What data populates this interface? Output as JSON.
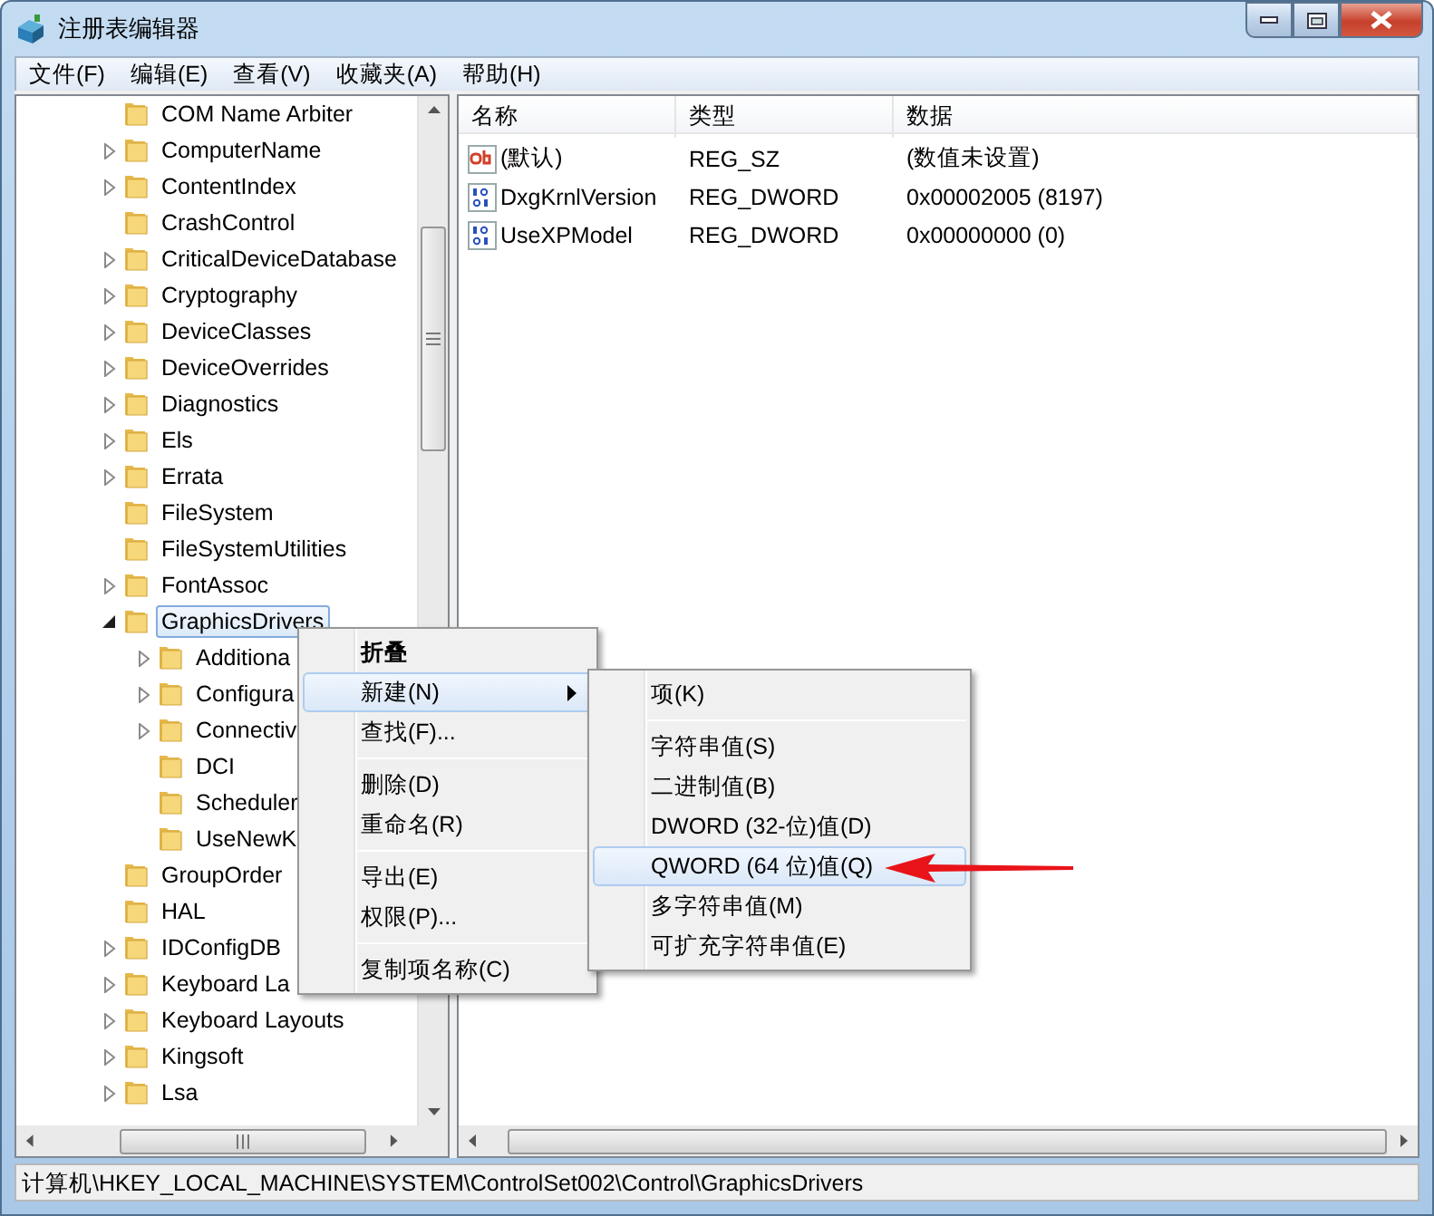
{
  "window": {
    "title": "注册表编辑器"
  },
  "menu_bar": [
    "文件(F)",
    "编辑(E)",
    "查看(V)",
    "收藏夹(A)",
    "帮助(H)"
  ],
  "tree": [
    {
      "label": "COM Name Arbiter",
      "has_children": false,
      "selected": false
    },
    {
      "label": "ComputerName",
      "has_children": true,
      "expanded": false,
      "selected": false
    },
    {
      "label": "ContentIndex",
      "has_children": true,
      "expanded": false,
      "selected": false
    },
    {
      "label": "CrashControl",
      "has_children": false,
      "selected": false
    },
    {
      "label": "CriticalDeviceDatabase",
      "has_children": true,
      "expanded": false,
      "selected": false
    },
    {
      "label": "Cryptography",
      "has_children": true,
      "expanded": false,
      "selected": false
    },
    {
      "label": "DeviceClasses",
      "has_children": true,
      "expanded": false,
      "selected": false
    },
    {
      "label": "DeviceOverrides",
      "has_children": true,
      "expanded": false,
      "selected": false
    },
    {
      "label": "Diagnostics",
      "has_children": true,
      "expanded": false,
      "selected": false
    },
    {
      "label": "Els",
      "has_children": true,
      "expanded": false,
      "selected": false
    },
    {
      "label": "Errata",
      "has_children": true,
      "expanded": false,
      "selected": false
    },
    {
      "label": "FileSystem",
      "has_children": false,
      "selected": false
    },
    {
      "label": "FileSystemUtilities",
      "has_children": false,
      "selected": false
    },
    {
      "label": "FontAssoc",
      "has_children": true,
      "expanded": false,
      "selected": false
    },
    {
      "label": "GraphicsDrivers",
      "has_children": true,
      "expanded": true,
      "selected": true,
      "children": [
        {
          "label": "Additiona",
          "has_children": true,
          "expanded": false,
          "selected": false
        },
        {
          "label": "Configura",
          "has_children": true,
          "expanded": false,
          "selected": false
        },
        {
          "label": "Connectiv",
          "has_children": true,
          "expanded": false,
          "selected": false
        },
        {
          "label": "DCI",
          "has_children": false,
          "selected": false
        },
        {
          "label": "Scheduler",
          "has_children": false,
          "selected": false
        },
        {
          "label": "UseNewK",
          "has_children": false,
          "selected": false
        }
      ]
    },
    {
      "label": "GroupOrder",
      "has_children": false,
      "selected": false
    },
    {
      "label": "HAL",
      "has_children": false,
      "selected": false
    },
    {
      "label": "IDConfigDB",
      "has_children": true,
      "expanded": false,
      "selected": false
    },
    {
      "label": "Keyboard La",
      "has_children": true,
      "expanded": false,
      "selected": false
    },
    {
      "label": "Keyboard Layouts",
      "has_children": true,
      "expanded": false,
      "selected": false
    },
    {
      "label": "Kingsoft",
      "has_children": true,
      "expanded": false,
      "selected": false
    },
    {
      "label": "Lsa",
      "has_children": true,
      "expanded": false,
      "selected": false
    }
  ],
  "values": {
    "columns": [
      "名称",
      "类型",
      "数据"
    ],
    "rows": [
      {
        "kind": "string",
        "name": "(默认)",
        "type": "REG_SZ",
        "data": "(数值未设置)"
      },
      {
        "kind": "binary",
        "name": "DxgKrnlVersion",
        "type": "REG_DWORD",
        "data": "0x00002005 (8197)"
      },
      {
        "kind": "binary",
        "name": "UseXPModel",
        "type": "REG_DWORD",
        "data": "0x00000000 (0)"
      }
    ]
  },
  "context_menu": [
    {
      "kind": "item",
      "label": "折叠",
      "default": true,
      "selected": false,
      "submenu": false
    },
    {
      "kind": "item",
      "label": "新建(N)",
      "default": false,
      "selected": true,
      "submenu": true
    },
    {
      "kind": "item",
      "label": "查找(F)...",
      "default": false,
      "selected": false,
      "submenu": false
    },
    {
      "kind": "separator"
    },
    {
      "kind": "item",
      "label": "删除(D)",
      "default": false,
      "selected": false,
      "submenu": false
    },
    {
      "kind": "item",
      "label": "重命名(R)",
      "default": false,
      "selected": false,
      "submenu": false
    },
    {
      "kind": "separator"
    },
    {
      "kind": "item",
      "label": "导出(E)",
      "default": false,
      "selected": false,
      "submenu": false
    },
    {
      "kind": "item",
      "label": "权限(P)...",
      "default": false,
      "selected": false,
      "submenu": false
    },
    {
      "kind": "separator"
    },
    {
      "kind": "item",
      "label": "复制项名称(C)",
      "default": false,
      "selected": false,
      "submenu": false
    }
  ],
  "submenu": [
    {
      "kind": "item",
      "label": "项(K)",
      "selected": false
    },
    {
      "kind": "separator"
    },
    {
      "kind": "item",
      "label": "字符串值(S)",
      "selected": false
    },
    {
      "kind": "item",
      "label": "二进制值(B)",
      "selected": false
    },
    {
      "kind": "item",
      "label": "DWORD (32-位)值(D)",
      "selected": false
    },
    {
      "kind": "item",
      "label": "QWORD (64 位)值(Q)",
      "selected": true
    },
    {
      "kind": "item",
      "label": "多字符串值(M)",
      "selected": false
    },
    {
      "kind": "item",
      "label": "可扩充字符串值(E)",
      "selected": false
    }
  ],
  "status_bar": "计算机\\HKEY_LOCAL_MACHINE\\SYSTEM\\ControlSet002\\Control\\GraphicsDrivers"
}
